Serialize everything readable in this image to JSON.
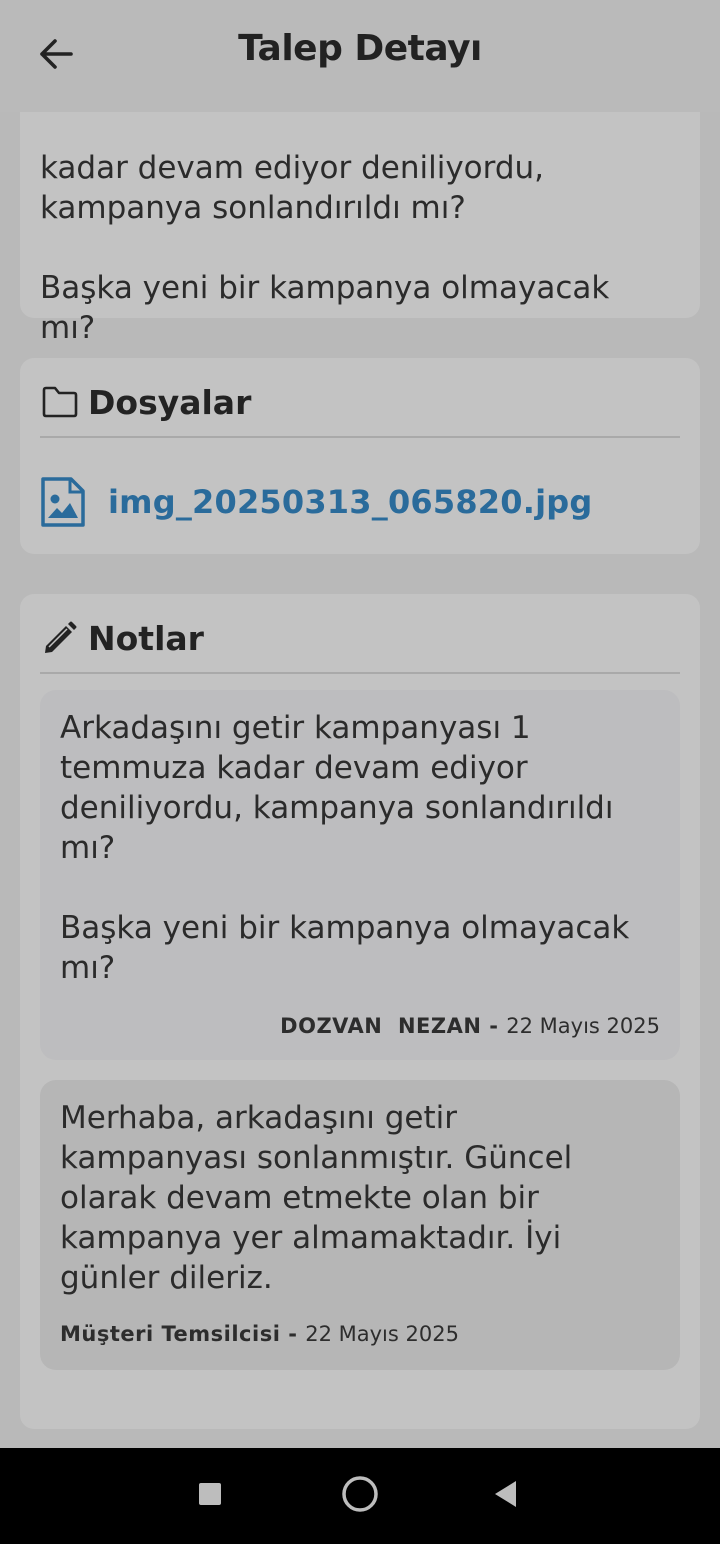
{
  "header": {
    "title": "Talep Detayı",
    "back_icon": "arrow-left-icon"
  },
  "description": {
    "text": "kadar devam ediyor deniliyordu,\nkampanya sonlandırıldı mı?\n\nBaşka yeni bir kampanya olmayacak\nmı?"
  },
  "files": {
    "title": "Dosyalar",
    "icon": "folder-icon",
    "items": [
      {
        "name": "img_20250313_065820.jpg",
        "icon": "image-file-icon"
      }
    ]
  },
  "notes": {
    "title": "Notlar",
    "icon": "pencil-icon",
    "items": [
      {
        "text": "Arkadaşını getir kampanyası 1\ntemmuza kadar devam ediyor\ndeniliyordu, kampanya sonlandırıldı\nmı?\n\nBaşka yeni bir kampanya olmayacak\nmı?",
        "author": "DOZVAN  NEZAN",
        "separator": " - ",
        "date": "22 Mayıs 2025"
      },
      {
        "text": "Merhaba, arkadaşını getir\nkampanyası sonlanmıştır. Güncel\nolarak devam etmekte olan bir\nkampanya yer almamaktadır. İyi\ngünler dileriz.",
        "author": "Müşteri Temsilcisi",
        "separator": " - ",
        "date": "22 Mayıs 2025"
      }
    ]
  },
  "navbar": {
    "icons": [
      "recents-square-icon",
      "home-circle-icon",
      "back-triangle-icon"
    ]
  },
  "colors": {
    "page_bg": "#b9b9b9",
    "card_bg": "#c3c3c3",
    "link": "#2a6b9b",
    "navbar": "#000000"
  }
}
